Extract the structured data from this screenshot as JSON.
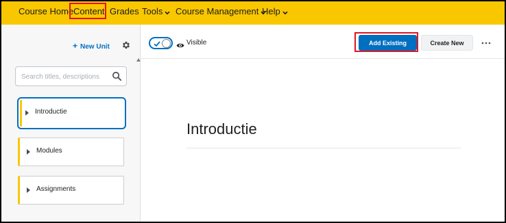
{
  "nav": {
    "items": [
      {
        "label": "Course Home",
        "dropdown": false
      },
      {
        "label": "Content",
        "dropdown": false,
        "highlighted": true
      },
      {
        "label": "Grades",
        "dropdown": false
      },
      {
        "label": "Tools",
        "dropdown": true
      },
      {
        "label": "Course Management",
        "dropdown": true
      },
      {
        "label": "Help",
        "dropdown": true
      }
    ],
    "background": "#f9c700"
  },
  "sidebar": {
    "new_unit_label": "New Unit",
    "new_unit_icon": "plus-icon",
    "settings_icon": "gear-icon",
    "search_placeholder": "Search titles, descriptions",
    "search_value": "",
    "units": [
      {
        "label": "Introductie",
        "selected": true
      },
      {
        "label": "Modules",
        "selected": false
      },
      {
        "label": "Assignments",
        "selected": false
      }
    ],
    "unit_accent": "#f9c700"
  },
  "toolbar": {
    "visibility_toggle_on": true,
    "visibility_label": "Visible",
    "add_existing_label": "Add Existing",
    "create_new_label": "Create New",
    "more_icon": "more-options-icon"
  },
  "main": {
    "title": "Introductie"
  },
  "colors": {
    "accent": "#006fbf",
    "highlight": "#e0141e"
  }
}
